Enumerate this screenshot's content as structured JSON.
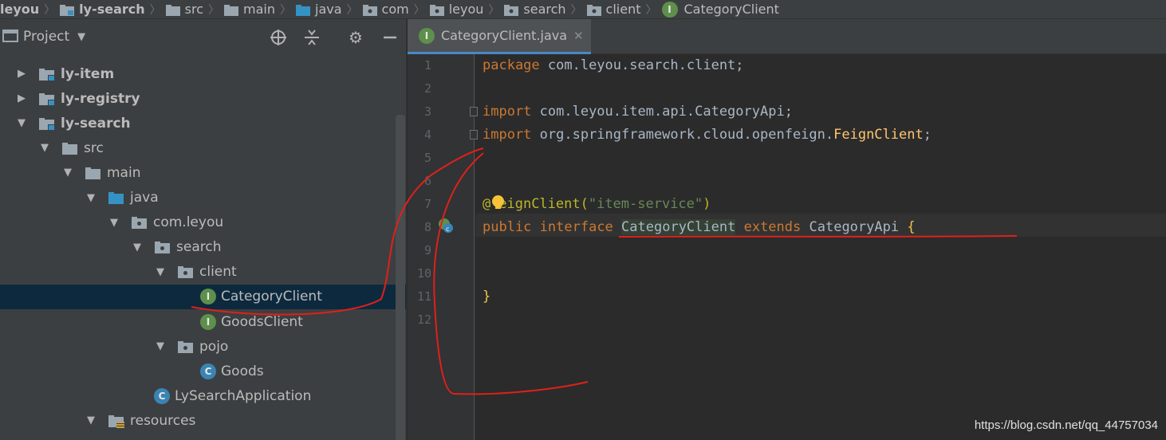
{
  "breadcrumb": [
    {
      "label": "leyou",
      "icon": "none",
      "bold": true
    },
    {
      "label": "ly-search",
      "icon": "module-folder-icon",
      "bold": true
    },
    {
      "label": "src",
      "icon": "folder-icon",
      "bold": false
    },
    {
      "label": "main",
      "icon": "folder-icon",
      "bold": false
    },
    {
      "label": "java",
      "icon": "source-folder-icon",
      "bold": false
    },
    {
      "label": "com",
      "icon": "package-icon",
      "bold": false
    },
    {
      "label": "leyou",
      "icon": "package-icon",
      "bold": false
    },
    {
      "label": "search",
      "icon": "package-icon",
      "bold": false
    },
    {
      "label": "client",
      "icon": "package-icon",
      "bold": false
    },
    {
      "label": "CategoryClient",
      "icon": "interface-icon",
      "bold": false
    }
  ],
  "project_panel": {
    "title": "Project",
    "tree": [
      {
        "label": "ly-item",
        "depth": 0,
        "expanded": false,
        "icon": "module",
        "bold": true,
        "selected": false
      },
      {
        "label": "ly-registry",
        "depth": 0,
        "expanded": false,
        "icon": "module",
        "bold": true,
        "selected": false
      },
      {
        "label": "ly-search",
        "depth": 0,
        "expanded": true,
        "icon": "module",
        "bold": true,
        "selected": false
      },
      {
        "label": "src",
        "depth": 1,
        "expanded": true,
        "icon": "folder",
        "bold": false,
        "selected": false
      },
      {
        "label": "main",
        "depth": 2,
        "expanded": true,
        "icon": "folder",
        "bold": false,
        "selected": false
      },
      {
        "label": "java",
        "depth": 3,
        "expanded": true,
        "icon": "source-folder",
        "bold": false,
        "selected": false
      },
      {
        "label": "com.leyou",
        "depth": 4,
        "expanded": true,
        "icon": "package",
        "bold": false,
        "selected": false
      },
      {
        "label": "search",
        "depth": 5,
        "expanded": true,
        "icon": "package",
        "bold": false,
        "selected": false
      },
      {
        "label": "client",
        "depth": 6,
        "expanded": true,
        "icon": "package",
        "bold": false,
        "selected": false
      },
      {
        "label": "CategoryClient",
        "depth": 7,
        "expanded": null,
        "icon": "interface",
        "bold": false,
        "selected": true
      },
      {
        "label": "GoodsClient",
        "depth": 7,
        "expanded": null,
        "icon": "interface",
        "bold": false,
        "selected": false
      },
      {
        "label": "pojo",
        "depth": 6,
        "expanded": true,
        "icon": "package",
        "bold": false,
        "selected": false
      },
      {
        "label": "Goods",
        "depth": 7,
        "expanded": null,
        "icon": "class",
        "bold": false,
        "selected": false
      },
      {
        "label": "LySearchApplication",
        "depth": 5,
        "expanded": null,
        "icon": "app-class",
        "bold": false,
        "selected": false
      },
      {
        "label": "resources",
        "depth": 3,
        "expanded": true,
        "icon": "resources-folder",
        "bold": false,
        "selected": false
      }
    ]
  },
  "editor": {
    "tab_label": "CategoryClient.java",
    "tab_icon_letter": "I",
    "line_numbers": [
      "1",
      "2",
      "3",
      "4",
      "5",
      "6",
      "7",
      "8",
      "9",
      "10",
      "11",
      "12"
    ],
    "code": {
      "l1_kw": "package",
      "l1_rest": " com.leyou.search.client;",
      "l3_kw": "import",
      "l3_rest": " com.leyou.item.api.CategoryApi;",
      "l4_kw": "import",
      "l4_rest": " org.springframework.cloud.openfeign.",
      "l4_cls": "FeignClient",
      "l4_end": ";",
      "l7_at": "@",
      "l7_ann": "eignClient(",
      "l7_str": "\"item-service\"",
      "l7_end": ")",
      "l8_kw1": "public",
      "l8_kw2": "interface",
      "l8_name": "CategoryClient",
      "l8_kw3": "extends",
      "l8_parent": "CategoryApi",
      "l8_brace": "{",
      "l11_brace": "}"
    }
  },
  "watermark": "https://blog.csdn.net/qq_44757034",
  "colors": {
    "background": "#2b2b2b",
    "panel": "#3c3f41",
    "keyword": "#cc7832",
    "string": "#6a8759",
    "annotation": "#bbb529",
    "selection": "#0d293e",
    "annotation_marks": "#e0201a"
  }
}
